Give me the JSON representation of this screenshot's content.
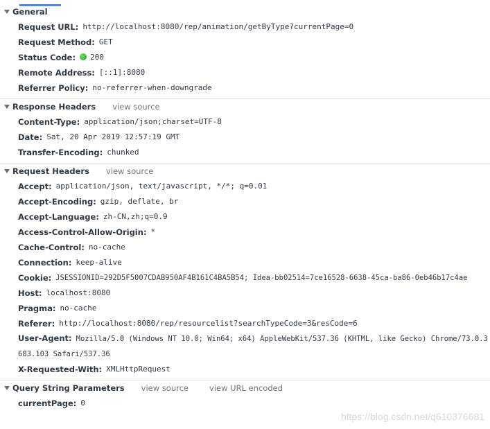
{
  "sections": {
    "general": {
      "title": "General",
      "rows": [
        {
          "key": "Request URL:",
          "value": "http://localhost:8080/rep/animation/getByType?currentPage=0"
        },
        {
          "key": "Request Method:",
          "value": "GET"
        },
        {
          "key": "Status Code:",
          "value": "200",
          "status_color": "#2ab52a"
        },
        {
          "key": "Remote Address:",
          "value": "[::1]:8080"
        },
        {
          "key": "Referrer Policy:",
          "value": "no-referrer-when-downgrade"
        }
      ]
    },
    "response_headers": {
      "title": "Response Headers",
      "view_source": "view source",
      "rows": [
        {
          "key": "Content-Type:",
          "value": "application/json;charset=UTF-8"
        },
        {
          "key": "Date:",
          "value": "Sat, 20 Apr 2019 12:57:19 GMT"
        },
        {
          "key": "Transfer-Encoding:",
          "value": "chunked"
        }
      ]
    },
    "request_headers": {
      "title": "Request Headers",
      "view_source": "view source",
      "rows": [
        {
          "key": "Accept:",
          "value": "application/json, text/javascript, */*; q=0.01"
        },
        {
          "key": "Accept-Encoding:",
          "value": "gzip, deflate, br"
        },
        {
          "key": "Accept-Language:",
          "value": "zh-CN,zh;q=0.9"
        },
        {
          "key": "Access-Control-Allow-Origin:",
          "value": "*"
        },
        {
          "key": "Cache-Control:",
          "value": "no-cache"
        },
        {
          "key": "Connection:",
          "value": "keep-alive"
        },
        {
          "key": "Cookie:",
          "value": "JSESSIONID=292D5F5007CDAB950AF4B161C4BA5B54; Idea-bb02514=7ce16528-6638-45ca-ba86-0eb46b17c4ae"
        },
        {
          "key": "Host:",
          "value": "localhost:8080"
        },
        {
          "key": "Pragma:",
          "value": "no-cache"
        },
        {
          "key": "Referer:",
          "value": "http://localhost:8080/rep/resourcelist?searchTypeCode=3&resCode=6"
        },
        {
          "key": "User-Agent:",
          "value": "Mozilla/5.0 (Windows NT 10.0; Win64; x64) AppleWebKit/537.36 (KHTML, like Gecko) Chrome/73.0.3683.103 Safari/537.36"
        },
        {
          "key": "X-Requested-With:",
          "value": "XMLHttpRequest"
        }
      ]
    },
    "query_string": {
      "title": "Query String Parameters",
      "view_source": "view source",
      "view_url_encoded": "view URL encoded",
      "rows": [
        {
          "key": "currentPage:",
          "value": "0"
        }
      ]
    }
  },
  "watermark": "https://blog.csdn.net/q610376681",
  "colors": {
    "accent_tab": "#4b87f0",
    "status_ok": "#2ab52a"
  }
}
